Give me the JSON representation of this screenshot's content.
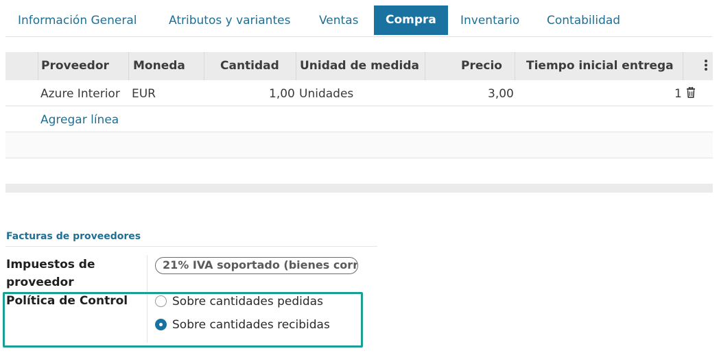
{
  "tabs": [
    {
      "label": "Información General",
      "active": false
    },
    {
      "label": "Atributos y variantes",
      "active": false
    },
    {
      "label": "Ventas",
      "active": false
    },
    {
      "label": "Compra",
      "active": true
    },
    {
      "label": "Inventario",
      "active": false
    },
    {
      "label": "Contabilidad",
      "active": false
    }
  ],
  "table": {
    "headers": {
      "vendor": "Proveedor",
      "currency": "Moneda",
      "quantity": "Cantidad",
      "uom": "Unidad de medida",
      "price": "Precio",
      "lead_time": "Tiempo inicial entrega"
    },
    "rows": [
      {
        "vendor": "Azure Interior",
        "currency": "EUR",
        "quantity": "1,00",
        "uom": "Unidades",
        "price": "3,00",
        "lead_time": "1"
      }
    ],
    "add_line_label": "Agregar línea",
    "row_delete_icon": "trash-icon",
    "column_options_icon": "kebab-menu-icon"
  },
  "vendor_bills": {
    "section_title": "Facturas de proveedores",
    "taxes_label": "Impuestos de proveedor",
    "taxes_tag": "21% IVA soportado (bienes corri...",
    "control_policy_label": "Política de Control",
    "control_policy_options": [
      {
        "label": "Sobre cantidades pedidas",
        "selected": false
      },
      {
        "label": "Sobre cantidades recibidas",
        "selected": true
      }
    ]
  },
  "colors": {
    "accent": "#1a72a0",
    "link": "#1f6f94",
    "highlight": "#1a9e95"
  }
}
